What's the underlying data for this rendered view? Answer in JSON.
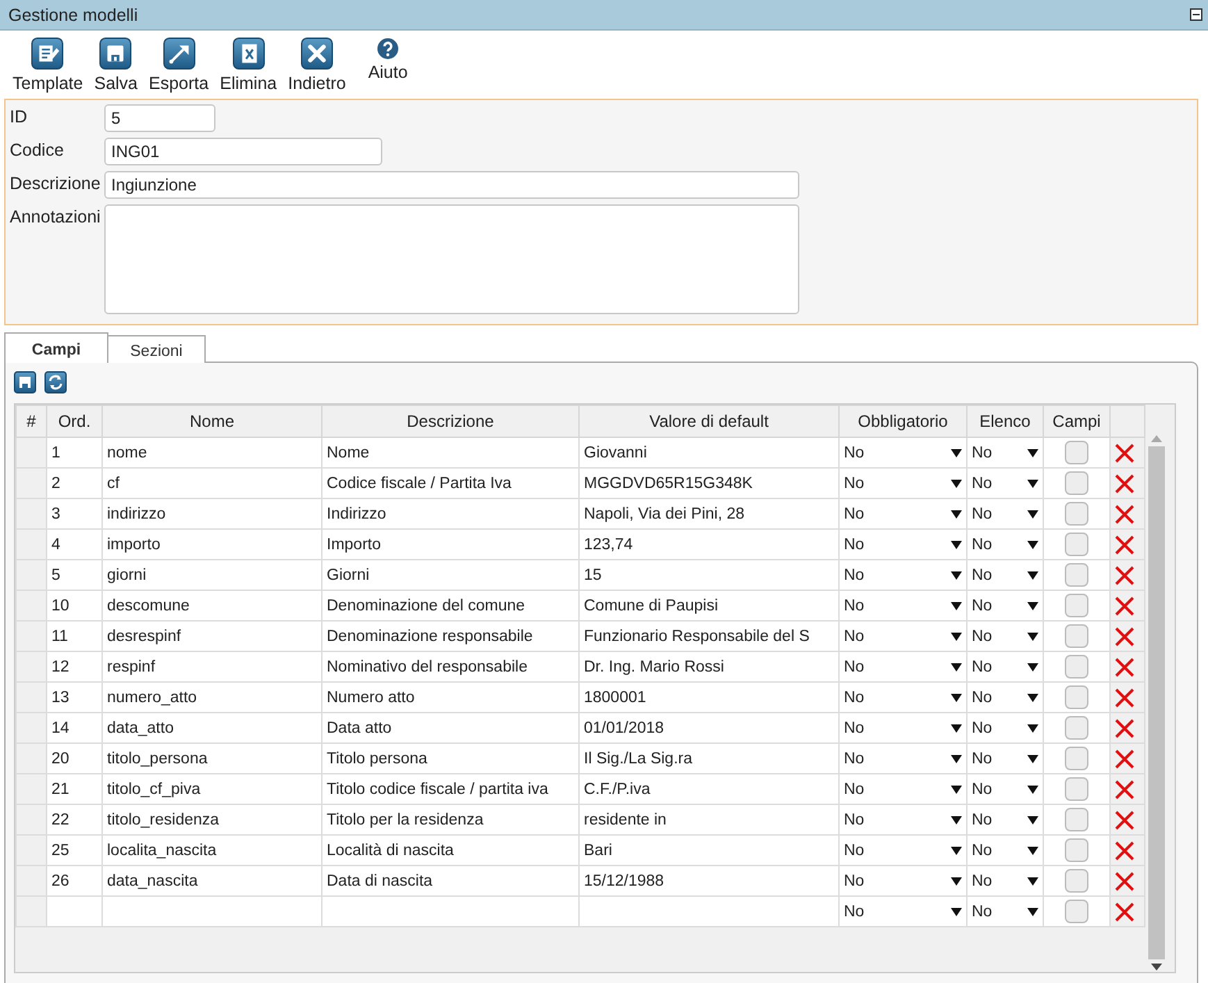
{
  "window": {
    "title": "Gestione modelli"
  },
  "toolbar": [
    {
      "label": "Template"
    },
    {
      "label": "Salva"
    },
    {
      "label": "Esporta"
    },
    {
      "label": "Elimina"
    },
    {
      "label": "Indietro"
    },
    {
      "label": "Aiuto"
    }
  ],
  "form": {
    "fields": [
      {
        "label": "ID",
        "value": "5",
        "kind": "short"
      },
      {
        "label": "Codice",
        "value": "ING01",
        "kind": "medium"
      },
      {
        "label": "Descrizione",
        "value": "Ingiunzione",
        "kind": "long"
      },
      {
        "label": "Annotazioni",
        "kind": "area"
      }
    ]
  },
  "tabs": [
    {
      "label": "Campi",
      "selected": true
    },
    {
      "label": "Sezioni",
      "selected": false
    }
  ],
  "table": {
    "columns": [
      "#",
      "Ord.",
      "Nome",
      "Descrizione",
      "Valore di default",
      "Obbligatorio",
      "Elenco",
      "Campi"
    ],
    "rows": [
      {
        "ord": "1",
        "nome": "nome",
        "descrizione": "Nome",
        "valore": "Giovanni",
        "obbligatorio": "No",
        "elenco": "No",
        "campi": false
      },
      {
        "ord": "2",
        "nome": "cf",
        "descrizione": "Codice fiscale / Partita Iva",
        "valore": "MGGDVD65R15G348K",
        "obbligatorio": "No",
        "elenco": "No",
        "campi": false
      },
      {
        "ord": "3",
        "nome": "indirizzo",
        "descrizione": "Indirizzo",
        "valore": "Napoli, Via dei Pini, 28",
        "obbligatorio": "No",
        "elenco": "No",
        "campi": false
      },
      {
        "ord": "4",
        "nome": "importo",
        "descrizione": "Importo",
        "valore": "123,74",
        "obbligatorio": "No",
        "elenco": "No",
        "campi": false
      },
      {
        "ord": "5",
        "nome": "giorni",
        "descrizione": "Giorni",
        "valore": "15",
        "obbligatorio": "No",
        "elenco": "No",
        "campi": false
      },
      {
        "ord": "10",
        "nome": "descomune",
        "descrizione": "Denominazione del comune",
        "valore": "Comune di Paupisi",
        "obbligatorio": "No",
        "elenco": "No",
        "campi": false
      },
      {
        "ord": "11",
        "nome": "desrespinf",
        "descrizione": "Denominazione responsabile",
        "valore": "Funzionario Responsabile del S",
        "obbligatorio": "No",
        "elenco": "No",
        "campi": false
      },
      {
        "ord": "12",
        "nome": "respinf",
        "descrizione": "Nominativo del responsabile",
        "valore": "Dr. Ing. Mario Rossi",
        "obbligatorio": "No",
        "elenco": "No",
        "campi": false
      },
      {
        "ord": "13",
        "nome": "numero_atto",
        "descrizione": "Numero atto",
        "valore": "1800001",
        "obbligatorio": "No",
        "elenco": "No",
        "campi": false
      },
      {
        "ord": "14",
        "nome": "data_atto",
        "descrizione": "Data atto",
        "valore": "01/01/2018",
        "obbligatorio": "No",
        "elenco": "No",
        "campi": false
      },
      {
        "ord": "20",
        "nome": "titolo_persona",
        "descrizione": "Titolo persona",
        "valore": "Il Sig./La Sig.ra",
        "obbligatorio": "No",
        "elenco": "No",
        "campi": false
      },
      {
        "ord": "21",
        "nome": "titolo_cf_piva",
        "descrizione": "Titolo codice fiscale / partita iva",
        "valore": "C.F./P.iva",
        "obbligatorio": "No",
        "elenco": "No",
        "campi": false
      },
      {
        "ord": "22",
        "nome": "titolo_residenza",
        "descrizione": "Titolo per la residenza",
        "valore": "residente in",
        "obbligatorio": "No",
        "elenco": "No",
        "campi": false
      },
      {
        "ord": "25",
        "nome": "localita_nascita",
        "descrizione": "Località di nascita",
        "valore": "Bari",
        "obbligatorio": "No",
        "elenco": "No",
        "campi": false
      },
      {
        "ord": "26",
        "nome": "data_nascita",
        "descrizione": "Data di nascita",
        "valore": "15/12/1988",
        "obbligatorio": "No",
        "elenco": "No",
        "campi": false
      },
      {
        "obbligatorio": "No",
        "elenco": "No",
        "campi": false
      }
    ]
  }
}
